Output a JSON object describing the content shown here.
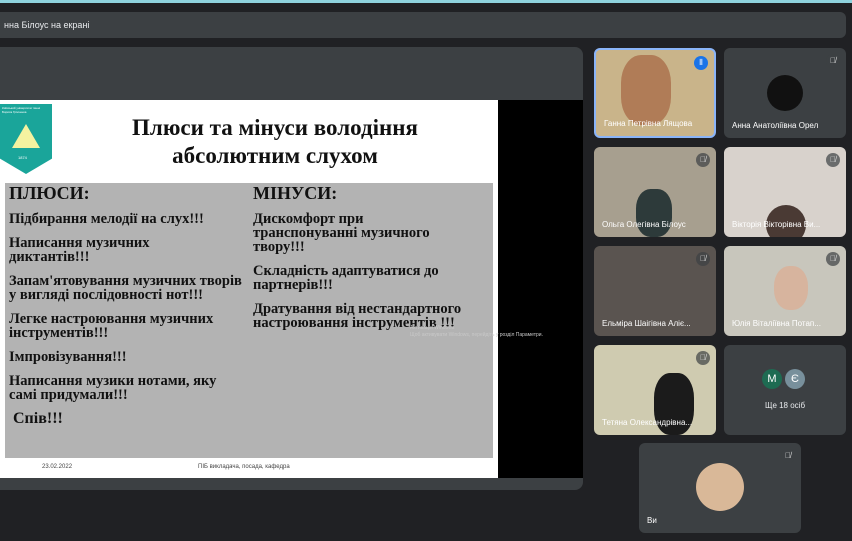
{
  "presenter_banner": "нна Білоус на екрані",
  "slide": {
    "logo_text": "Київський університет імені Бориса Грінченка",
    "logo_year": "1874",
    "title_line1": "Плюси та мінуси володіння",
    "title_line2": "абсолютним слухом",
    "pros_header": "ПЛЮСИ:",
    "pros": [
      "Підбирання мелодії на слух!!!",
      "Написання музичних диктантів!!!",
      "Запам'ятовування музичних творів у вигляді послідовності нот!!!",
      "Легке настроювання музичних інструментів!!!",
      "Імпровізування!!!",
      "Написання музики нотами, яку самі придумали!!!",
      "Спів!!!"
    ],
    "cons_header": "МІНУСИ:",
    "cons": [
      "Дискомфорт при транспонуванні музичного твору!!!",
      "Складність адаптуватися до партнерів!!!",
      "Дратування від нестандартного настроювання інструментів !!!"
    ],
    "activation_title": "Активація Windows",
    "activation_text": "Щоб активувати Windows, перейдіть у розділ Параметри.",
    "footer_date": "23.02.2022",
    "footer_text": "ПІБ викладача, посада, кафедра"
  },
  "participants": [
    {
      "name": "Ганна Петрівна Лящова",
      "speaking": true
    },
    {
      "name": "Анна Анатоліївна Орел"
    },
    {
      "name": "Ольга Олегівна Білоус"
    },
    {
      "name": "Вікторія Вікторівна Ви..."
    },
    {
      "name": "Ельміра Шаігівна Аліє..."
    },
    {
      "name": "Юлія Віталіївна Потап..."
    },
    {
      "name": "Тетяна Олександрівна..."
    }
  ],
  "more": {
    "initials": [
      "М",
      "Є"
    ],
    "label": "Ще 18 осіб"
  },
  "self": {
    "name": "Ви"
  },
  "colors": {
    "accent": "#8ab4f8",
    "avatar_m": "#1e6b52",
    "avatar_e": "#78909c"
  }
}
